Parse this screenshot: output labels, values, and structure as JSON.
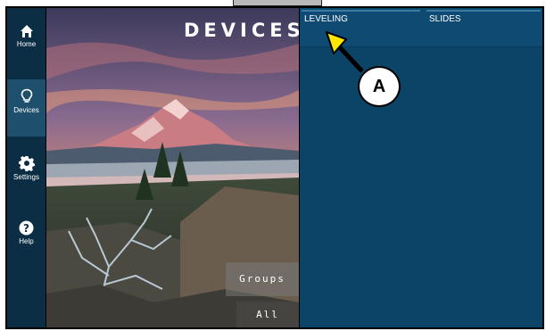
{
  "app": {
    "title": "DEVICES"
  },
  "sidebar": {
    "items": [
      {
        "label": "Home",
        "icon": "home-icon"
      },
      {
        "label": "Devices",
        "icon": "lightbulb-icon",
        "active": true
      },
      {
        "label": "Settings",
        "icon": "gear-icon"
      },
      {
        "label": "Help",
        "icon": "help-icon"
      }
    ]
  },
  "photo_buttons": {
    "groups": "Groups",
    "all": "All"
  },
  "tabs": [
    {
      "label": "LEVELING",
      "active": true
    },
    {
      "label": "SLIDES"
    }
  ],
  "callout": {
    "label": "A"
  },
  "colors": {
    "sidebar": "#0b2e44",
    "sidebar_active": "#1e4f6c",
    "panel": "#0c4468",
    "callout_arrow": "#ffe600"
  }
}
